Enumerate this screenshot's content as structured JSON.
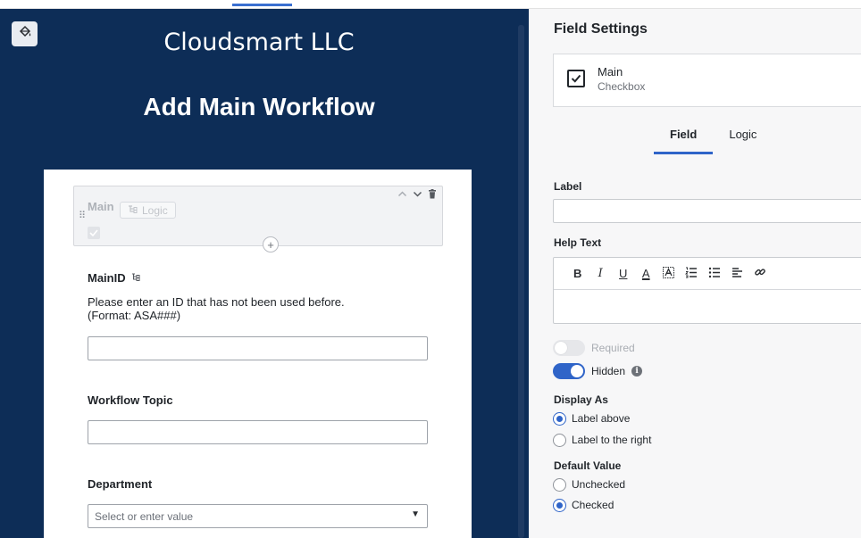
{
  "colors": {
    "canvas_bg": "#0d2d57",
    "accent": "#2f64c8",
    "panel_bg": "#f7f7f8"
  },
  "canvas": {
    "theme_button_icon": "paint-bucket-icon",
    "brand": "Cloudsmart LLC",
    "title": "Add Main Workflow",
    "main_block": {
      "label": "Main",
      "logic_chip": "Logic",
      "hidden_check": true
    },
    "questions": [
      {
        "label": "MainID",
        "help_line1": "Please enter an ID that has not been used before.",
        "help_line2": "(Format: ASA###)",
        "value": ""
      },
      {
        "label": "Workflow Topic",
        "value": ""
      },
      {
        "label": "Department",
        "placeholder": "Select or enter value"
      }
    ]
  },
  "panel": {
    "title": "Field Settings",
    "field_card": {
      "name": "Main",
      "type": "Checkbox",
      "icon": "checkbox-icon",
      "edit_icon": "pencil-icon"
    },
    "tabs": [
      {
        "label": "Field",
        "active": true
      },
      {
        "label": "Logic",
        "active": false
      }
    ],
    "label_title": "Label",
    "label_value": "",
    "help_text_title": "Help Text",
    "rte_buttons": [
      {
        "icon": "bold-icon",
        "glyph": "B"
      },
      {
        "icon": "italic-icon",
        "glyph": "I"
      },
      {
        "icon": "underline-icon",
        "glyph": "U"
      },
      {
        "icon": "font-color-icon",
        "glyph": "A"
      },
      {
        "icon": "highlight-icon",
        "glyph": "A"
      },
      {
        "icon": "numbered-list-icon",
        "glyph": "≡"
      },
      {
        "icon": "bullet-list-icon",
        "glyph": "≡"
      },
      {
        "icon": "align-icon",
        "glyph": "≡"
      },
      {
        "icon": "link-icon",
        "glyph": "⚭"
      }
    ],
    "required": {
      "label": "Required",
      "on": false
    },
    "hidden": {
      "label": "Hidden",
      "on": true
    },
    "display_as": {
      "title": "Display As",
      "options": [
        {
          "label": "Label above",
          "checked": true
        },
        {
          "label": "Label to the right",
          "checked": false
        }
      ]
    },
    "default_value": {
      "title": "Default Value",
      "options": [
        {
          "label": "Unchecked",
          "checked": false
        },
        {
          "label": "Checked",
          "checked": true
        }
      ]
    }
  }
}
